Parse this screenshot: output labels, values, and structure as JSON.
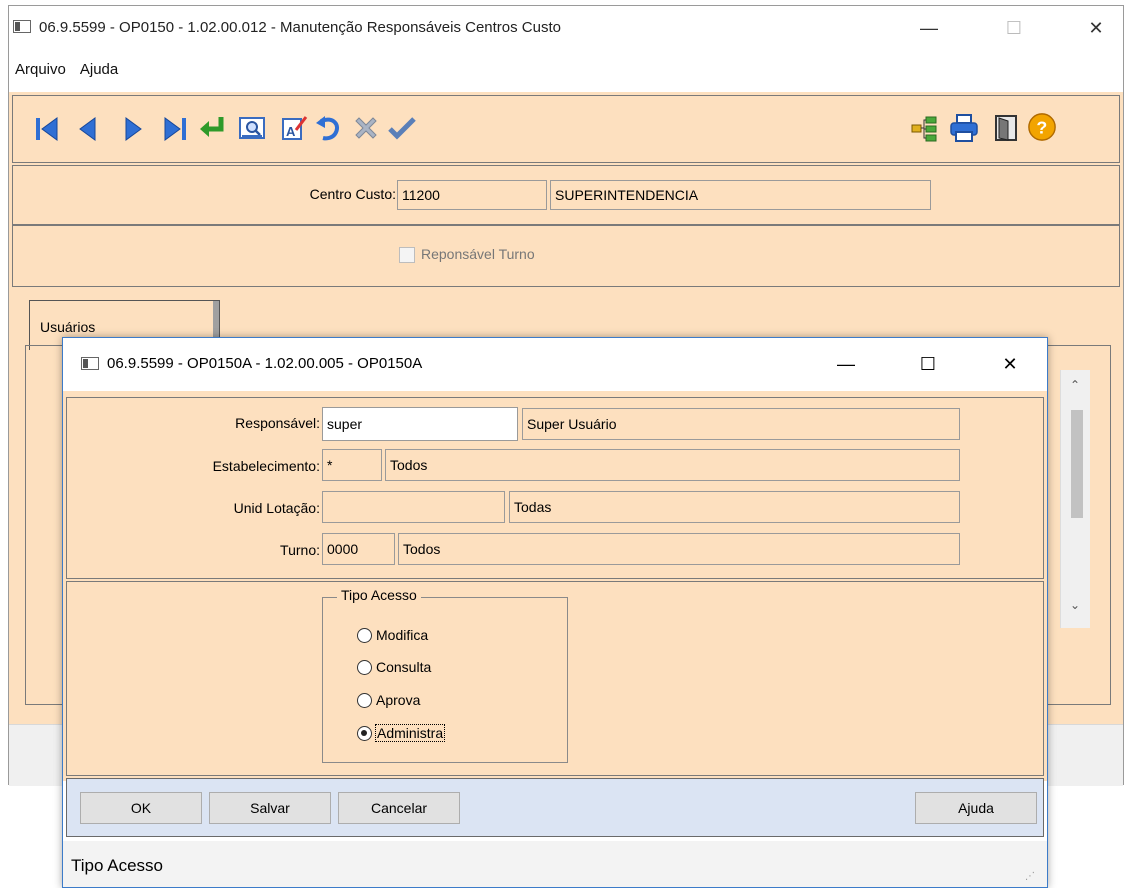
{
  "main_window": {
    "title": "06.9.5599 - OP0150 - 1.02.00.012 - Manutenção Responsáveis Centros Custo",
    "menu": [
      "Arquivo",
      "Ajuda"
    ],
    "window_controls": {
      "minimize": "—",
      "maximize": "☐",
      "close": "✕"
    }
  },
  "toolbar": {
    "left_icons": [
      "first-record-icon",
      "previous-record-icon",
      "next-record-icon",
      "last-record-icon",
      "go-to-icon",
      "search-icon",
      "edit-icon",
      "undo-icon",
      "delete-icon",
      "confirm-icon"
    ],
    "right_icons": [
      "hierarchy-icon",
      "print-icon",
      "exit-icon",
      "help-icon"
    ]
  },
  "centro_custo": {
    "label": "Centro Custo:",
    "code": "11200",
    "description": "SUPERINTENDENCIA"
  },
  "responsavel_turno": {
    "label": "Reponsável Turno",
    "checked": false
  },
  "tabs": [
    {
      "label": "Usuários"
    }
  ],
  "dialog": {
    "title": "06.9.5599 - OP0150A - 1.02.00.005 - OP0150A",
    "window_controls": {
      "minimize": "—",
      "maximize": "☐",
      "close": "✕"
    },
    "responsavel": {
      "label": "Responsável:",
      "value": "super",
      "description": "Super Usuário"
    },
    "estabelecimento": {
      "label": "Estabelecimento:",
      "value": "*",
      "description": "Todos"
    },
    "unid_lotacao": {
      "label": "Unid Lotação:",
      "value": "",
      "description": "Todas"
    },
    "turno": {
      "label": "Turno:",
      "value": "0000",
      "description": "Todos"
    },
    "tipo_acesso": {
      "legend": "Tipo Acesso",
      "options": [
        "Modifica",
        "Consulta",
        "Aprova",
        "Administra"
      ],
      "selected": "Administra"
    },
    "buttons": {
      "ok": "OK",
      "salvar": "Salvar",
      "cancelar": "Cancelar",
      "ajuda": "Ajuda"
    },
    "status_text": "Tipo Acesso"
  },
  "colors": {
    "panel_background": "#fde0bf",
    "button_bar": "#dbe4f3",
    "dialog_border": "#3c7bc9"
  }
}
